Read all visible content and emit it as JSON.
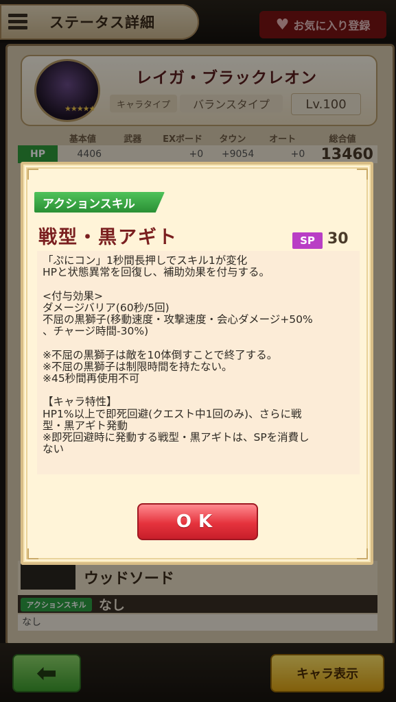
{
  "header": {
    "title": "ステータス詳細",
    "favorite_label": "お気に入り登録"
  },
  "profile": {
    "name": "レイガ・ブラックレオン",
    "type_label": "キャラタイプ",
    "type_value": "バランスタイプ",
    "level": "Lv.100",
    "stars": "★★★★★"
  },
  "stats": {
    "headers": [
      "基本値",
      "武器",
      "EXボード",
      "タウン",
      "オート",
      "総合値"
    ],
    "hp_label": "HP",
    "hp_values": [
      "4406",
      "",
      "+0",
      "+9054",
      "+0"
    ],
    "hp_total": "13460"
  },
  "weapon": {
    "name": "ウッドソード",
    "skill_tag": "アクションスキル",
    "skill_value": "なし",
    "skill_desc": "なし"
  },
  "footer": {
    "chara_button": "キャラ表示"
  },
  "dialog": {
    "skill_type": "アクションスキル",
    "skill_name": "戦型・黒アギト",
    "sp_label": "SP",
    "sp_value": "30",
    "description": "「ぷにコン」1秒間長押しでスキル1が変化\nHPと状態異常を回復し、補助効果を付与する。\n\n<付与効果>\nダメージバリア(60秒/5回)\n不屈の黒獅子(移動速度・攻撃速度・会心ダメージ+50%\n、チャージ時間-30%)\n\n※不屈の黒獅子は敵を10体倒すことで終了する。\n※不屈の黒獅子は制限時間を持たない。\n※45秒間再使用不可\n\n【キャラ特性】\nHP1%以上で即死回避(クエスト中1回のみ)、さらに戦\n型・黒アギト発動\n※即死回避時に発動する戦型・黒アギトは、SPを消費し\nない",
    "ok_label": "OK"
  }
}
